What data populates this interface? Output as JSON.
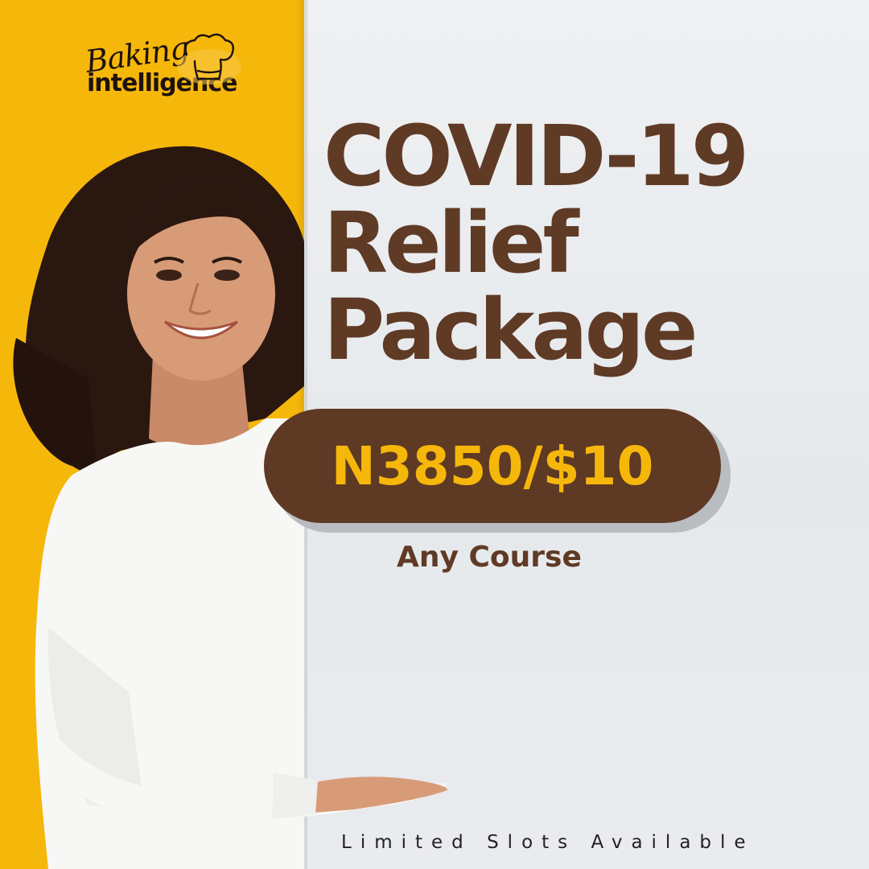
{
  "brand": {
    "script": "Baking",
    "word": "intelligence",
    "icon": "chef-hat-icon"
  },
  "headline": {
    "line1": "COVID-19",
    "line2": "Relief",
    "line3": "Package"
  },
  "offer": {
    "price": "N3850/$10",
    "subtitle": "Any Course"
  },
  "footer": {
    "note": "Limited Slots Available"
  },
  "colors": {
    "yellow": "#f6b70b",
    "brown": "#5e3923",
    "background": "#e9ecef"
  },
  "image": {
    "subject": "smiling-woman-icon"
  }
}
